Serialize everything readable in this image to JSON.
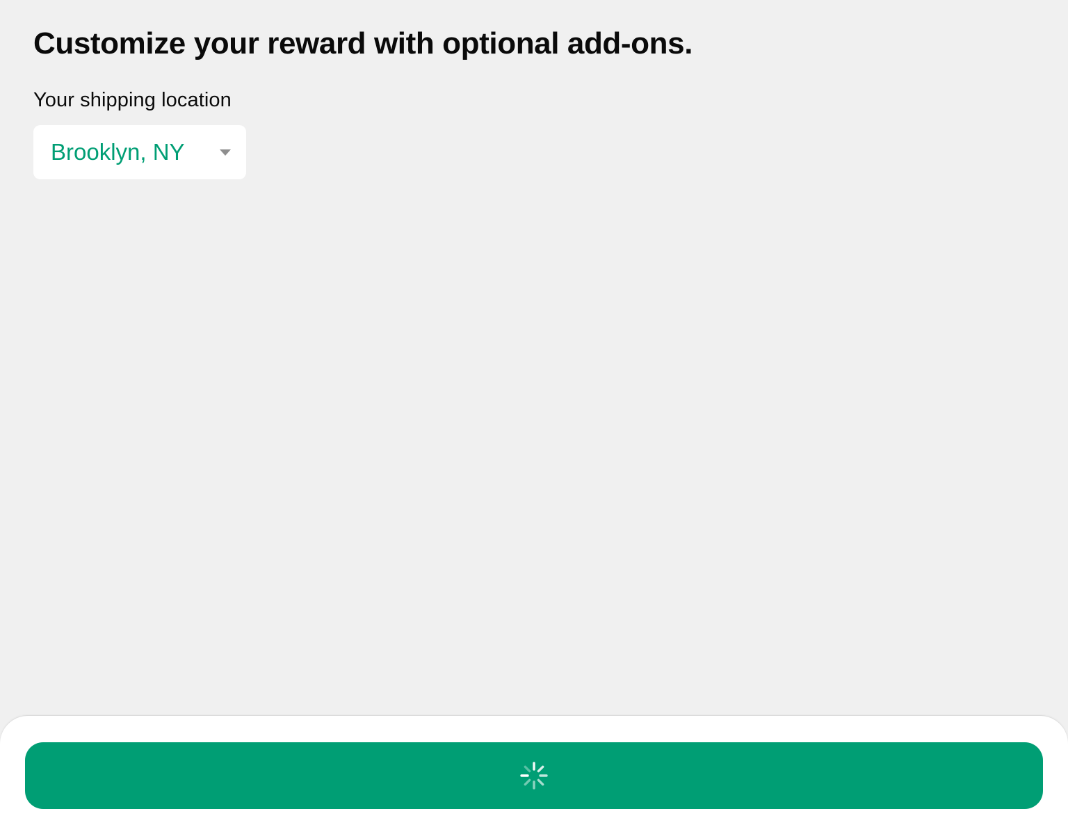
{
  "header": {
    "title": "Customize your reward with optional add-ons."
  },
  "shipping": {
    "label": "Your shipping location",
    "selected_location": "Brooklyn, NY",
    "dropdown_icon": "chevron-down-icon"
  },
  "footer": {
    "continue_button_state": "loading",
    "spinner_icon": "loading-spinner-icon"
  },
  "colors": {
    "background": "#f0f0f0",
    "accent": "#009e74",
    "title_text": "#0a0a0a",
    "card": "#ffffff"
  }
}
